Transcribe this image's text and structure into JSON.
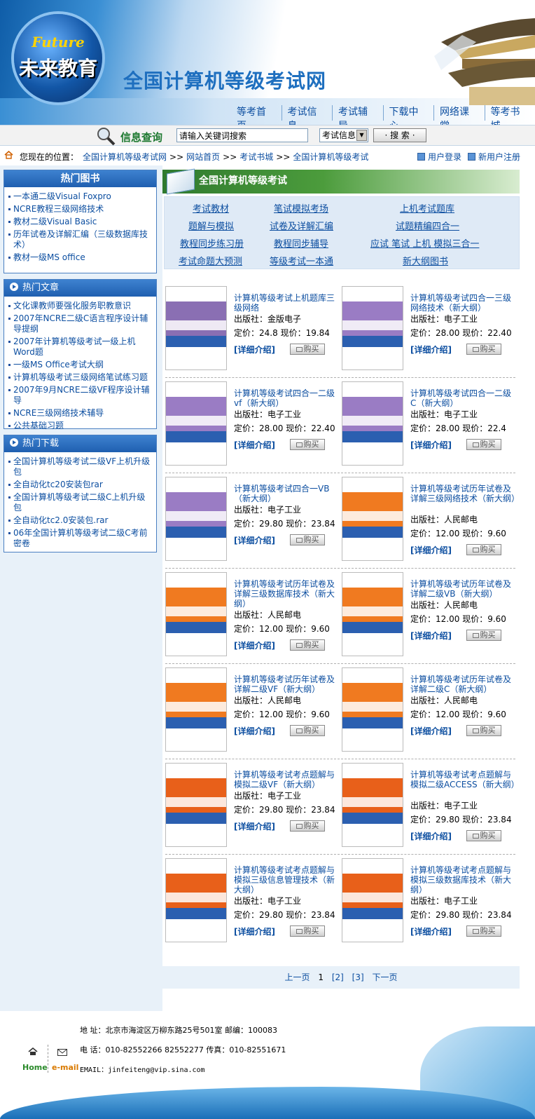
{
  "header": {
    "logo_en": "Future",
    "logo_cn": "未来教育",
    "site_title": "全国计算机等级考试网",
    "nav": [
      "等考首页",
      "考试信息",
      "考试辅导",
      "下载中心",
      "网络课堂",
      "等考书城"
    ]
  },
  "search": {
    "label": "信息查询",
    "placeholder": "请输入关键词搜索",
    "scope": "考试信息",
    "button": "· 搜 索 ·"
  },
  "breadcrumb": {
    "prefix": "您现在的位置：",
    "items": [
      "全国计算机等级考试网",
      "网站首页",
      "考试书城",
      "全国计算机等级考试"
    ],
    "sep": ">>",
    "login": "用户登录",
    "register": "新用户注册"
  },
  "sidebar": {
    "hot_books": {
      "title": "热门图书",
      "items": [
        "一本通二级Visual Foxpro",
        "NCRE教程三级网络技术",
        "教材二级Visual Basic",
        "历年试卷及详解汇编（三级数据库技术）",
        "教材一级MS office"
      ]
    },
    "hot_articles": {
      "title": "热门文章",
      "items": [
        "文化课教师要强化服务职教意识",
        "2007年NCRE二级C语言程序设计辅导提纲",
        "2007年计算机等级考试一级上机Word题",
        "一级MS Office考试大纲",
        "计算机等级考试三级网络笔试练习题",
        "2007年9月NCRE二级VF程序设计辅导",
        "NCRE三级网络技术辅导",
        "公共基础习题"
      ]
    },
    "hot_downloads": {
      "title": "热门下载",
      "items": [
        "全国计算机等级考试二级VF上机升级包",
        "全自动化tc20安装包rar",
        "全国计算机等级考试二级C上机升级包",
        "全自动化tc2.0安装包.rar",
        "06年全国计算机等级考试二级C考前密卷"
      ]
    }
  },
  "section": {
    "title": "全国计算机等级考试",
    "categories": [
      "考试教材",
      "笔试模拟考场",
      "上机考试题库",
      "题解与模拟",
      "试卷及详解汇编",
      "试题精编四合一",
      "教程同步练习册",
      "教程同步辅导",
      "应试 笔试 上机 模拟三合一",
      "考试命题大预测",
      "等级考试一本通",
      "新大纲图书"
    ]
  },
  "book_labels": {
    "publisher": "出版社：",
    "list_price": "定价：",
    "our_price": "现价：",
    "detail": "[详细介绍]",
    "buy": "购买"
  },
  "books": [
    {
      "title": "计算机等级考试上机题库三级网络",
      "publisher": "金版电子",
      "list_price": "24.8",
      "price": "19.84",
      "cover_color": "#8a6fb3"
    },
    {
      "title": "计算机等级考试四合一三级网络技术（新大纲）",
      "publisher": "电子工业",
      "list_price": "28.00",
      "price": "22.40",
      "cover_color": "#9a7cc4"
    },
    {
      "title": "计算机等级考试四合一二级vf（新大纲）",
      "publisher": "电子工业",
      "list_price": "28.00",
      "price": "22.40",
      "cover_color": "#9a7cc4"
    },
    {
      "title": "计算机等级考试四合一二级C（新大纲）",
      "publisher": "电子工业",
      "list_price": "28.00",
      "price": "22.4",
      "cover_color": "#9a7cc4"
    },
    {
      "title": "计算机等级考试四合一VB（新大纲）",
      "publisher": "电子工业",
      "list_price": "29.80",
      "price": "23.84",
      "cover_color": "#9a7cc4"
    },
    {
      "title": "计算机等级考试历年试卷及详解三级网络技术（新大纲）",
      "publisher": "人民邮电",
      "list_price": "12.00",
      "price": "9.60",
      "cover_color": "#f07a20"
    },
    {
      "title": "计算机等级考试历年试卷及详解三级数据库技术（新大纲）",
      "publisher": "人民邮电",
      "list_price": "12.00",
      "price": "9.60",
      "cover_color": "#f07a20"
    },
    {
      "title": "计算机等级考试历年试卷及详解二级VB（新大纲）",
      "publisher": "人民邮电",
      "list_price": "12.00",
      "price": "9.60",
      "cover_color": "#f07a20"
    },
    {
      "title": "计算机等级考试历年试卷及详解二级VF（新大纲）",
      "publisher": "人民邮电",
      "list_price": "12.00",
      "price": "9.60",
      "cover_color": "#f07a20"
    },
    {
      "title": "计算机等级考试历年试卷及详解二级C（新大纲）",
      "publisher": "人民邮电",
      "list_price": "12.00",
      "price": "9.60",
      "cover_color": "#f07a20"
    },
    {
      "title": "计算机等级考试考点题解与模拟二级VF（新大纲）",
      "publisher": "电子工业",
      "list_price": "29.80",
      "price": "23.84",
      "cover_color": "#e8601a"
    },
    {
      "title": "计算机等级考试考点题解与模拟二级ACCESS（新大纲）",
      "publisher": "电子工业",
      "list_price": "29.80",
      "price": "23.84",
      "cover_color": "#e8601a"
    },
    {
      "title": "计算机等级考试考点题解与模拟三级信息管理技术（新大纲）",
      "publisher": "电子工业",
      "list_price": "29.80",
      "price": "23.84",
      "cover_color": "#e8601a"
    },
    {
      "title": "计算机等级考试考点题解与模拟三级数据库技术（新大纲）",
      "publisher": "电子工业",
      "list_price": "29.80",
      "price": "23.84",
      "cover_color": "#e8601a"
    }
  ],
  "pager": {
    "prev": "上一页",
    "current": "1",
    "page2": "[2]",
    "page3": "[3]",
    "next": "下一页"
  },
  "footer": {
    "home": "Home",
    "email": "e-mail",
    "address": "地  址：北京市海淀区万柳东路25号501室   邮编：100083",
    "phone": "电  话：010-82552266  82552277  传真：010-82551671",
    "email_line": "EMAIL：jinfeiteng@vip.sina.com"
  }
}
